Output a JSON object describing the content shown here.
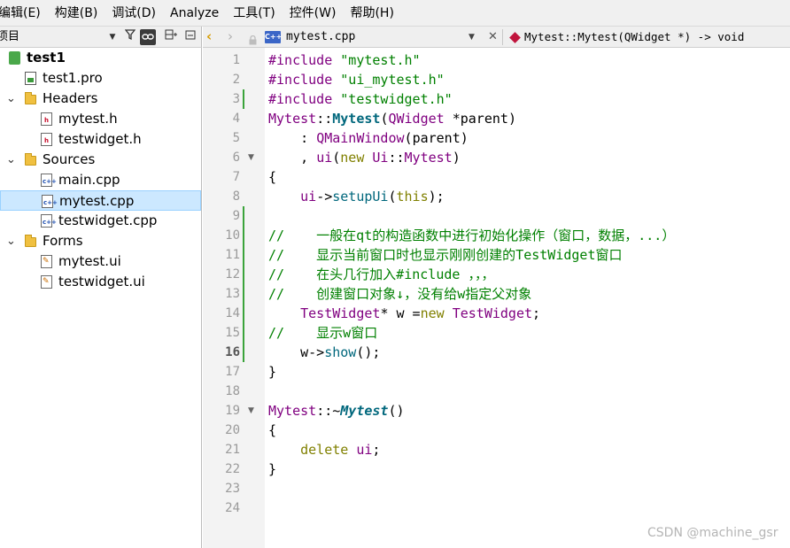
{
  "menubar": {
    "items": [
      "编辑(E)",
      "构建(B)",
      "调试(D)",
      "Analyze",
      "工具(T)",
      "控件(W)",
      "帮助(H)"
    ]
  },
  "projects_pane": {
    "title": "项目",
    "tree": [
      {
        "label": "test1",
        "icon": "qt-project-icon",
        "depth": 0,
        "expandable": false,
        "bold": true,
        "selected": false
      },
      {
        "label": "test1.pro",
        "icon": "pro-file-icon",
        "depth": 1,
        "expandable": false,
        "bold": false,
        "selected": false
      },
      {
        "label": "Headers",
        "icon": "folder-icon",
        "depth": 1,
        "expandable": true,
        "bold": false,
        "selected": false
      },
      {
        "label": "mytest.h",
        "icon": "header-file-icon",
        "depth": 2,
        "expandable": false,
        "bold": false,
        "selected": false
      },
      {
        "label": "testwidget.h",
        "icon": "header-file-icon",
        "depth": 2,
        "expandable": false,
        "bold": false,
        "selected": false
      },
      {
        "label": "Sources",
        "icon": "folder-icon",
        "depth": 1,
        "expandable": true,
        "bold": false,
        "selected": false
      },
      {
        "label": "main.cpp",
        "icon": "cpp-file-icon",
        "depth": 2,
        "expandable": false,
        "bold": false,
        "selected": false
      },
      {
        "label": "mytest.cpp",
        "icon": "cpp-file-icon",
        "depth": 2,
        "expandable": false,
        "bold": false,
        "selected": true
      },
      {
        "label": "testwidget.cpp",
        "icon": "cpp-file-icon",
        "depth": 2,
        "expandable": false,
        "bold": false,
        "selected": false
      },
      {
        "label": "Forms",
        "icon": "forms-folder-icon",
        "depth": 1,
        "expandable": true,
        "bold": false,
        "selected": false
      },
      {
        "label": "mytest.ui",
        "icon": "ui-file-icon",
        "depth": 2,
        "expandable": false,
        "bold": false,
        "selected": false
      },
      {
        "label": "testwidget.ui",
        "icon": "ui-file-icon",
        "depth": 2,
        "expandable": false,
        "bold": false,
        "selected": false
      }
    ]
  },
  "editor": {
    "current_file": "mytest.cpp",
    "file_type_badge": "C++",
    "current_symbol": "Mytest::Mytest(QWidget *) -> void",
    "current_line": 16,
    "modified_lines": [
      3,
      9,
      10,
      11,
      12,
      13,
      14,
      15,
      16
    ],
    "fold_markers": [
      6,
      19
    ],
    "colors": {
      "keyword": "#808000",
      "string": "#008000",
      "comment": "#008000",
      "type": "#800080",
      "function": "#00677c",
      "plain": "#000000",
      "gutter_bg": "#f3f3f3",
      "selection_bg": "#cce8ff",
      "modified_marker": "#3aa33a"
    },
    "lines": [
      [
        {
          "t": "#include ",
          "c": "type"
        },
        {
          "t": "\"mytest.h\"",
          "c": "string"
        }
      ],
      [
        {
          "t": "#include ",
          "c": "type"
        },
        {
          "t": "\"ui_mytest.h\"",
          "c": "string"
        }
      ],
      [
        {
          "t": "#include ",
          "c": "type"
        },
        {
          "t": "\"testwidget.h\"",
          "c": "string"
        }
      ],
      [
        {
          "t": "Mytest",
          "c": "type"
        },
        {
          "t": "::",
          "c": "plain"
        },
        {
          "t": "Mytest",
          "c": "function_bold"
        },
        {
          "t": "(",
          "c": "plain"
        },
        {
          "t": "QWidget",
          "c": "type"
        },
        {
          "t": " *",
          "c": "plain"
        },
        {
          "t": "parent",
          "c": "plain"
        },
        {
          "t": ")",
          "c": "plain"
        }
      ],
      [
        {
          "t": "    : ",
          "c": "plain"
        },
        {
          "t": "QMainWindow",
          "c": "type"
        },
        {
          "t": "(",
          "c": "plain"
        },
        {
          "t": "parent",
          "c": "plain"
        },
        {
          "t": ")",
          "c": "plain"
        }
      ],
      [
        {
          "t": "    , ",
          "c": "plain"
        },
        {
          "t": "ui",
          "c": "type"
        },
        {
          "t": "(",
          "c": "plain"
        },
        {
          "t": "new",
          "c": "keyword"
        },
        {
          "t": " ",
          "c": "plain"
        },
        {
          "t": "Ui",
          "c": "type"
        },
        {
          "t": "::",
          "c": "plain"
        },
        {
          "t": "Mytest",
          "c": "type"
        },
        {
          "t": ")",
          "c": "plain"
        }
      ],
      [
        {
          "t": "{",
          "c": "plain"
        }
      ],
      [
        {
          "t": "    ",
          "c": "plain"
        },
        {
          "t": "ui",
          "c": "type"
        },
        {
          "t": "->",
          "c": "plain"
        },
        {
          "t": "setupUi",
          "c": "function"
        },
        {
          "t": "(",
          "c": "plain"
        },
        {
          "t": "this",
          "c": "keyword"
        },
        {
          "t": ");",
          "c": "plain"
        }
      ],
      [
        {
          "t": "",
          "c": "plain"
        }
      ],
      [
        {
          "t": "//    一般在qt的构造函数中进行初始化操作（窗口，数据，...）",
          "c": "comment"
        }
      ],
      [
        {
          "t": "//    显示当前窗口时也显示刚刚创建的TestWidget窗口",
          "c": "comment"
        }
      ],
      [
        {
          "t": "//    在头几行加入#include ，，，",
          "c": "comment"
        }
      ],
      [
        {
          "t": "//    创建窗口对象↓，没有给w指定父对象",
          "c": "comment"
        }
      ],
      [
        {
          "t": "    ",
          "c": "plain"
        },
        {
          "t": "TestWidget",
          "c": "type"
        },
        {
          "t": "* ",
          "c": "plain"
        },
        {
          "t": "w",
          "c": "plain"
        },
        {
          "t": " =",
          "c": "plain"
        },
        {
          "t": "new",
          "c": "keyword"
        },
        {
          "t": " ",
          "c": "plain"
        },
        {
          "t": "TestWidget",
          "c": "type"
        },
        {
          "t": ";",
          "c": "plain"
        }
      ],
      [
        {
          "t": "//    显示w窗口",
          "c": "comment"
        }
      ],
      [
        {
          "t": "    ",
          "c": "plain"
        },
        {
          "t": "w",
          "c": "plain"
        },
        {
          "t": "->",
          "c": "plain"
        },
        {
          "t": "show",
          "c": "function"
        },
        {
          "t": "();",
          "c": "plain"
        }
      ],
      [
        {
          "t": "}",
          "c": "plain"
        }
      ],
      [
        {
          "t": "",
          "c": "plain"
        }
      ],
      [
        {
          "t": "Mytest",
          "c": "type"
        },
        {
          "t": "::~",
          "c": "plain"
        },
        {
          "t": "Mytest",
          "c": "function_bold_italic"
        },
        {
          "t": "()",
          "c": "plain"
        }
      ],
      [
        {
          "t": "{",
          "c": "plain"
        }
      ],
      [
        {
          "t": "    ",
          "c": "plain"
        },
        {
          "t": "delete",
          "c": "keyword"
        },
        {
          "t": " ",
          "c": "plain"
        },
        {
          "t": "ui",
          "c": "type"
        },
        {
          "t": ";",
          "c": "plain"
        }
      ],
      [
        {
          "t": "}",
          "c": "plain"
        }
      ],
      [
        {
          "t": "",
          "c": "plain"
        }
      ],
      [
        {
          "t": "",
          "c": "plain"
        }
      ]
    ]
  },
  "watermark": "CSDN @machine_gsr"
}
